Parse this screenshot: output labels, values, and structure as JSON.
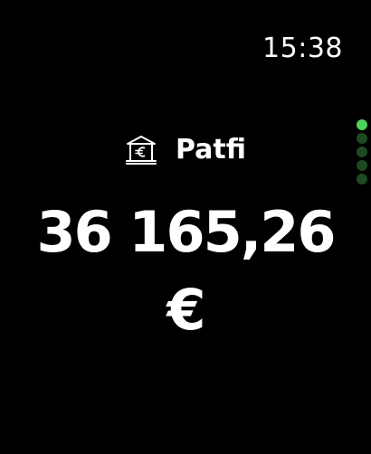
{
  "status_bar": {
    "time": "15:38"
  },
  "header": {
    "icon": "bank-euro-icon",
    "app_name": "Patfi"
  },
  "balance": {
    "amount": "36 165,26",
    "currency": "€"
  },
  "page_indicator": {
    "total": 5,
    "active_index": 0,
    "active_color": "#4cd15a",
    "inactive_color": "#1e4a22"
  },
  "colors": {
    "background": "#000000",
    "text": "#ffffff"
  }
}
